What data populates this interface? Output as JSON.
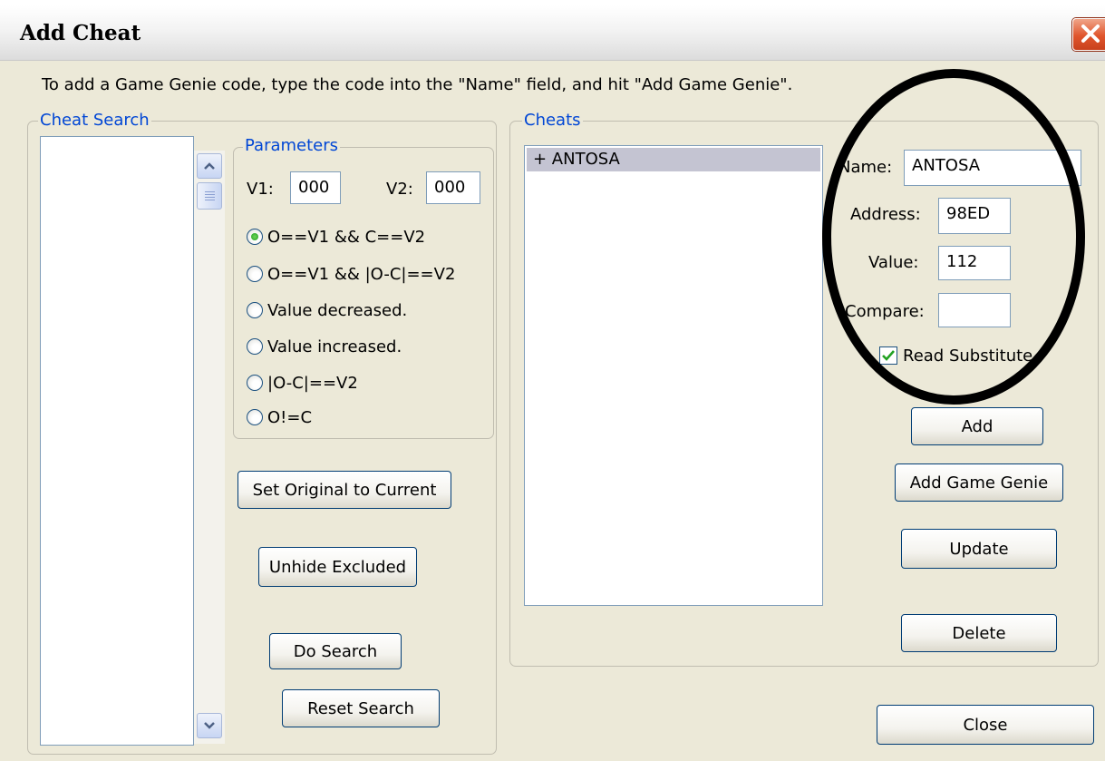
{
  "window": {
    "title": "Add Cheat"
  },
  "instructions": "To add a Game Genie code, type the code into the \"Name\" field, and hit \"Add Game Genie\".",
  "cheat_search": {
    "label": "Cheat Search",
    "parameters": {
      "label": "Parameters",
      "v1_label": "V1:",
      "v1_value": "000",
      "v2_label": "V2:",
      "v2_value": "000",
      "options": [
        {
          "label": "O==V1 && C==V2",
          "selected": true
        },
        {
          "label": "O==V1 && |O-C|==V2",
          "selected": false
        },
        {
          "label": "Value decreased.",
          "selected": false
        },
        {
          "label": "Value increased.",
          "selected": false
        },
        {
          "label": "|O-C|==V2",
          "selected": false
        },
        {
          "label": "O!=C",
          "selected": false
        }
      ]
    },
    "buttons": {
      "set_original": "Set Original to Current",
      "unhide_excluded": "Unhide Excluded",
      "do_search": "Do Search",
      "reset_search": "Reset Search"
    }
  },
  "cheats": {
    "label": "Cheats",
    "items": [
      "+ ANTOSA"
    ],
    "fields": {
      "name_label": "Name:",
      "name_value": "ANTOSA",
      "address_label": "Address:",
      "address_value": "98ED",
      "value_label": "Value:",
      "value_value": "112",
      "compare_label": "Compare:",
      "compare_value": ""
    },
    "read_substitute": {
      "label": "Read Substitute",
      "checked": true
    },
    "buttons": {
      "add": "Add",
      "add_game_genie": "Add Game Genie",
      "update": "Update",
      "delete": "Delete"
    }
  },
  "close_label": "Close",
  "colors": {
    "dialog_bg": "#ece9d8",
    "group_label": "#0046d5",
    "close_button": "#e0552c",
    "radio_selected": "#21a121",
    "checkmark": "#21a121",
    "annotation_ellipse": "#000000"
  }
}
